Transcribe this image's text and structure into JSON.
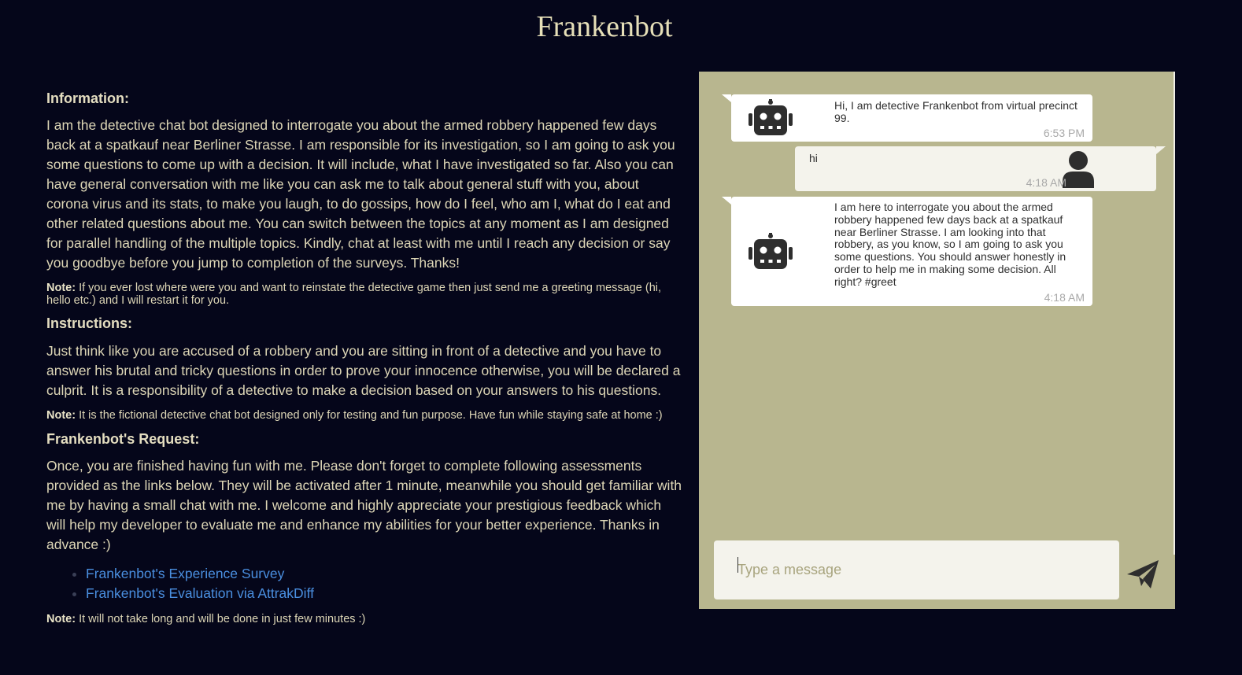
{
  "page": {
    "title": "Frankenbot"
  },
  "info": {
    "information_heading": "Information:",
    "information_text": "I am the detective chat bot designed to interrogate you about the armed robbery happened few days back at a spatkauf near Berliner Strasse. I am responsible for its investigation, so I am going to ask you some questions to come up with a decision. It will include, what I have investigated so far. Also you can have general conversation with me like you can ask me to talk about general stuff with you, about corona virus and its stats, to make you laugh, to do gossips, how do I feel, who am I, what do I eat and other related questions about me. You can switch between the topics at any moment as I am designed for parallel handling of the multiple topics. Kindly, chat at least with me until I reach any decision or say you goodbye before you jump to completion of the surveys. Thanks!",
    "note1_label": "Note:",
    "note1_text": " If you ever lost where were you and want to reinstate the detective game then just send me a greeting message (hi, hello etc.) and I will restart it for you.",
    "instructions_heading": "Instructions:",
    "instructions_text": "Just think like you are accused of a robbery and you are sitting in front of a detective and you have to answer his brutal and tricky questions in order to prove your innocence otherwise, you will be declared a culprit. It is a responsibility of a detective to make a decision based on your answers to his questions.",
    "note2_label": "Note:",
    "note2_text": " It is the fictional detective chat bot designed only for testing and fun purpose. Have fun while staying safe at home :)",
    "request_heading": "Frankenbot's Request:",
    "request_text": "Once, you are finished having fun with me. Please don't forget to complete following assessments provided as the links below. They will be activated after 1 minute, meanwhile you should get familiar with me by having a small chat with me. I welcome and highly appreciate your prestigious feedback which will help my developer to evaluate me and enhance my abilities for your better experience. Thanks in advance :)",
    "links": [
      "Frankenbot's Experience Survey",
      "Frankenbot's Evaluation via AttrakDiff"
    ],
    "note3_label": "Note:",
    "note3_text": " It will not take long and will be done in just few minutes :)"
  },
  "chat": {
    "messages": [
      {
        "sender": "bot",
        "text": "Hi, I am detective Frankenbot from virtual precinct 99.",
        "time": "6:53 PM",
        "icon": "robot-icon"
      },
      {
        "sender": "user",
        "text": "hi",
        "time": "4:18 AM",
        "icon": "user-icon"
      },
      {
        "sender": "bot",
        "text": "I am here to interrogate you about the armed robbery happened few days back at a spatkauf near Berliner Strasse. I am looking into that robbery, as you know, so I am going to ask you some questions. You should answer honestly in order to help me in making some decision. All right? #greet",
        "time": "4:18 AM",
        "icon": "robot-icon"
      }
    ],
    "input_placeholder": "Type a message",
    "input_value": "",
    "send_icon": "paper-plane-icon"
  },
  "colors": {
    "background": "#05061a",
    "chat_background": "#b8b68f",
    "text": "#ddd6b6",
    "link": "#4a8fe0"
  }
}
